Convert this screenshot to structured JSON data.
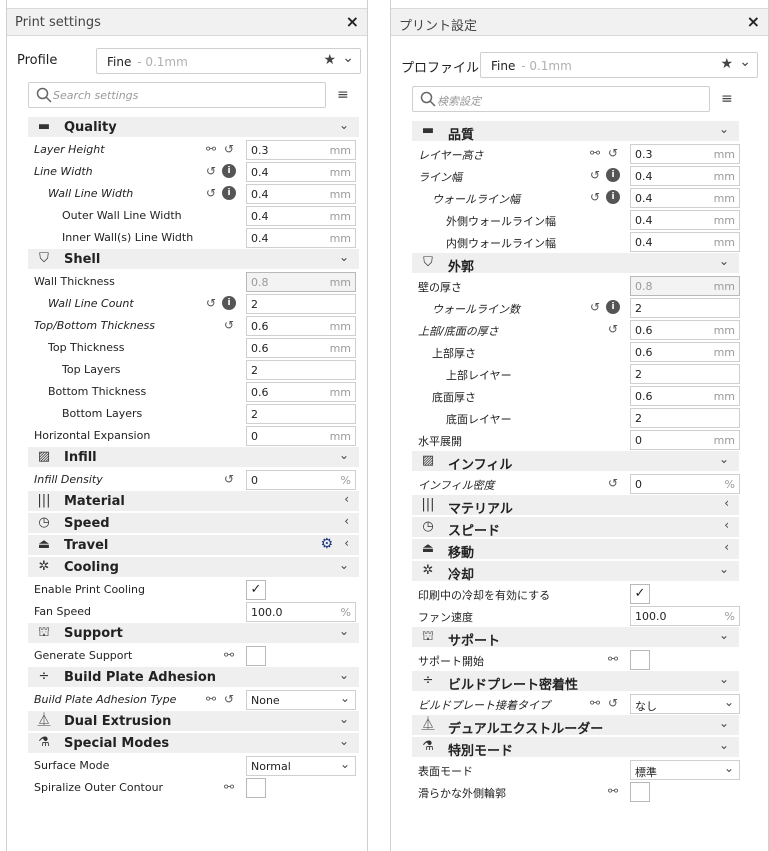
{
  "left": {
    "title": "Print settings",
    "close": "×",
    "profile_label": "Profile",
    "profile_name": "Fine",
    "profile_sub": "- 0.1mm",
    "search_placeholder": "Search settings",
    "rows": [
      {
        "kind": "cat",
        "icon": "quality-icon",
        "glyph": "▬",
        "label": "Quality",
        "arrow": "⌄"
      },
      {
        "kind": "setting",
        "label": "Layer Height",
        "italic": true,
        "indent": 0,
        "icons": [
          "link-icon",
          "reset-icon"
        ],
        "field": {
          "value": "0.3",
          "unit": "mm"
        }
      },
      {
        "kind": "setting",
        "label": "Line Width",
        "italic": true,
        "indent": 0,
        "icons": [
          "reset-icon",
          "info-icon"
        ],
        "field": {
          "value": "0.4",
          "unit": "mm"
        }
      },
      {
        "kind": "setting",
        "label": "Wall Line Width",
        "italic": true,
        "indent": 1,
        "icons": [
          "reset-icon",
          "info-icon"
        ],
        "field": {
          "value": "0.4",
          "unit": "mm"
        }
      },
      {
        "kind": "setting",
        "label": "Outer Wall Line Width",
        "italic": false,
        "indent": 2,
        "icons": [],
        "field": {
          "value": "0.4",
          "unit": "mm"
        }
      },
      {
        "kind": "setting",
        "label": "Inner Wall(s) Line Width",
        "italic": false,
        "indent": 2,
        "icons": [],
        "field": {
          "value": "0.4",
          "unit": "mm"
        }
      },
      {
        "kind": "cat",
        "icon": "shell-icon",
        "glyph": "⛉",
        "label": "Shell",
        "arrow": "⌄"
      },
      {
        "kind": "setting",
        "label": "Wall Thickness",
        "italic": false,
        "indent": 0,
        "icons": [],
        "field": {
          "value": "0.8",
          "unit": "mm",
          "disabled": true
        }
      },
      {
        "kind": "setting",
        "label": "Wall Line Count",
        "italic": true,
        "indent": 1,
        "icons": [
          "reset-icon",
          "info-icon"
        ],
        "field": {
          "value": "2",
          "unit": ""
        }
      },
      {
        "kind": "setting",
        "label": "Top/Bottom Thickness",
        "italic": true,
        "indent": 0,
        "icons": [
          "reset-icon"
        ],
        "field": {
          "value": "0.6",
          "unit": "mm"
        }
      },
      {
        "kind": "setting",
        "label": "Top Thickness",
        "italic": false,
        "indent": 1,
        "icons": [],
        "field": {
          "value": "0.6",
          "unit": "mm"
        }
      },
      {
        "kind": "setting",
        "label": "Top Layers",
        "italic": false,
        "indent": 2,
        "icons": [],
        "field": {
          "value": "2",
          "unit": ""
        }
      },
      {
        "kind": "setting",
        "label": "Bottom Thickness",
        "italic": false,
        "indent": 1,
        "icons": [],
        "field": {
          "value": "0.6",
          "unit": "mm"
        }
      },
      {
        "kind": "setting",
        "label": "Bottom Layers",
        "italic": false,
        "indent": 2,
        "icons": [],
        "field": {
          "value": "2",
          "unit": ""
        }
      },
      {
        "kind": "setting",
        "label": "Horizontal Expansion",
        "italic": false,
        "indent": 0,
        "icons": [],
        "field": {
          "value": "0",
          "unit": "mm"
        }
      },
      {
        "kind": "cat",
        "icon": "infill-icon",
        "glyph": "▨",
        "label": "Infill",
        "arrow": "⌄"
      },
      {
        "kind": "setting",
        "label": "Infill Density",
        "italic": true,
        "indent": 0,
        "icons": [
          "reset-icon"
        ],
        "field": {
          "value": "0",
          "unit": "%"
        }
      },
      {
        "kind": "cat",
        "icon": "material-icon",
        "glyph": "|||",
        "label": "Material",
        "arrow": "‹"
      },
      {
        "kind": "cat",
        "icon": "speed-icon",
        "glyph": "◷",
        "label": "Speed",
        "arrow": "‹"
      },
      {
        "kind": "cat",
        "icon": "travel-icon",
        "glyph": "⏏",
        "label": "Travel",
        "arrow": "‹",
        "gear": true
      },
      {
        "kind": "cat",
        "icon": "cooling-icon",
        "glyph": "✲",
        "label": "Cooling",
        "arrow": "⌄"
      },
      {
        "kind": "setting",
        "label": "Enable Print Cooling",
        "italic": false,
        "indent": 0,
        "icons": [],
        "check": "✓"
      },
      {
        "kind": "setting",
        "label": "Fan Speed",
        "italic": false,
        "indent": 0,
        "icons": [],
        "field": {
          "value": "100.0",
          "unit": "%"
        }
      },
      {
        "kind": "cat",
        "icon": "support-icon",
        "glyph": "⛫",
        "label": "Support",
        "arrow": "⌄"
      },
      {
        "kind": "setting",
        "label": "Generate Support",
        "italic": false,
        "indent": 0,
        "icons": [
          "link-icon"
        ],
        "check": ""
      },
      {
        "kind": "cat",
        "icon": "adhesion-icon",
        "glyph": "÷",
        "label": "Build Plate Adhesion",
        "arrow": "⌄"
      },
      {
        "kind": "setting",
        "label": "Build Plate Adhesion Type",
        "italic": true,
        "indent": 0,
        "icons": [
          "link-icon",
          "reset-icon"
        ],
        "select": "None"
      },
      {
        "kind": "cat",
        "icon": "dual-extrusion-icon",
        "glyph": "⏅",
        "label": "Dual Extrusion",
        "arrow": "⌄"
      },
      {
        "kind": "cat",
        "icon": "special-modes-icon",
        "glyph": "⚗",
        "label": "Special Modes",
        "arrow": "⌄"
      },
      {
        "kind": "setting",
        "label": "Surface Mode",
        "italic": false,
        "indent": 0,
        "icons": [],
        "select": "Normal"
      },
      {
        "kind": "setting",
        "label": "Spiralize Outer Contour",
        "italic": false,
        "indent": 0,
        "icons": [
          "link-icon"
        ],
        "check": ""
      }
    ]
  },
  "right": {
    "title": "プリント設定",
    "close": "×",
    "profile_label": "プロファイル",
    "profile_name": "Fine",
    "profile_sub": "- 0.1mm",
    "search_placeholder": "検索設定",
    "rows": [
      {
        "kind": "cat",
        "icon": "quality-icon",
        "glyph": "▬",
        "label": "品質",
        "arrow": "⌄"
      },
      {
        "kind": "setting",
        "label": "レイヤー高さ",
        "italic": true,
        "indent": 0,
        "icons": [
          "link-icon",
          "reset-icon"
        ],
        "field": {
          "value": "0.3",
          "unit": "mm"
        }
      },
      {
        "kind": "setting",
        "label": "ライン幅",
        "italic": true,
        "indent": 0,
        "icons": [
          "reset-icon",
          "info-icon"
        ],
        "field": {
          "value": "0.4",
          "unit": "mm"
        }
      },
      {
        "kind": "setting",
        "label": "ウォールライン幅",
        "italic": true,
        "indent": 1,
        "icons": [
          "reset-icon",
          "info-icon"
        ],
        "field": {
          "value": "0.4",
          "unit": "mm"
        }
      },
      {
        "kind": "setting",
        "label": "外側ウォールライン幅",
        "italic": false,
        "indent": 2,
        "icons": [],
        "field": {
          "value": "0.4",
          "unit": "mm"
        }
      },
      {
        "kind": "setting",
        "label": "内側ウォールライン幅",
        "italic": false,
        "indent": 2,
        "icons": [],
        "field": {
          "value": "0.4",
          "unit": "mm"
        }
      },
      {
        "kind": "cat",
        "icon": "shell-icon",
        "glyph": "⛉",
        "label": "外郭",
        "arrow": "⌄"
      },
      {
        "kind": "setting",
        "label": "壁の厚さ",
        "italic": false,
        "indent": 0,
        "icons": [],
        "field": {
          "value": "0.8",
          "unit": "mm",
          "disabled": true
        }
      },
      {
        "kind": "setting",
        "label": "ウォールライン数",
        "italic": true,
        "indent": 1,
        "icons": [
          "reset-icon",
          "info-icon"
        ],
        "field": {
          "value": "2",
          "unit": ""
        }
      },
      {
        "kind": "setting",
        "label": "上部/底面の厚さ",
        "italic": true,
        "indent": 0,
        "icons": [
          "reset-icon"
        ],
        "field": {
          "value": "0.6",
          "unit": "mm"
        }
      },
      {
        "kind": "setting",
        "label": "上部厚さ",
        "italic": false,
        "indent": 1,
        "icons": [],
        "field": {
          "value": "0.6",
          "unit": "mm"
        }
      },
      {
        "kind": "setting",
        "label": "上部レイヤー",
        "italic": false,
        "indent": 2,
        "icons": [],
        "field": {
          "value": "2",
          "unit": ""
        }
      },
      {
        "kind": "setting",
        "label": "底面厚さ",
        "italic": false,
        "indent": 1,
        "icons": [],
        "field": {
          "value": "0.6",
          "unit": "mm"
        }
      },
      {
        "kind": "setting",
        "label": "底面レイヤー",
        "italic": false,
        "indent": 2,
        "icons": [],
        "field": {
          "value": "2",
          "unit": ""
        }
      },
      {
        "kind": "setting",
        "label": "水平展開",
        "italic": false,
        "indent": 0,
        "icons": [],
        "field": {
          "value": "0",
          "unit": "mm"
        }
      },
      {
        "kind": "cat",
        "icon": "infill-icon",
        "glyph": "▨",
        "label": "インフィル",
        "arrow": "⌄"
      },
      {
        "kind": "setting",
        "label": "インフィル密度",
        "italic": true,
        "indent": 0,
        "icons": [
          "reset-icon"
        ],
        "field": {
          "value": "0",
          "unit": "%"
        }
      },
      {
        "kind": "cat",
        "icon": "material-icon",
        "glyph": "|||",
        "label": "マテリアル",
        "arrow": "‹"
      },
      {
        "kind": "cat",
        "icon": "speed-icon",
        "glyph": "◷",
        "label": "スピード",
        "arrow": "‹"
      },
      {
        "kind": "cat",
        "icon": "travel-icon",
        "glyph": "⏏",
        "label": "移動",
        "arrow": "‹"
      },
      {
        "kind": "cat",
        "icon": "cooling-icon",
        "glyph": "✲",
        "label": "冷却",
        "arrow": "⌄"
      },
      {
        "kind": "setting",
        "label": "印刷中の冷却を有効にする",
        "italic": false,
        "indent": 0,
        "icons": [],
        "check": "✓"
      },
      {
        "kind": "setting",
        "label": "ファン速度",
        "italic": false,
        "indent": 0,
        "icons": [],
        "field": {
          "value": "100.0",
          "unit": "%"
        }
      },
      {
        "kind": "cat",
        "icon": "support-icon",
        "glyph": "⛫",
        "label": "サポート",
        "arrow": "⌄"
      },
      {
        "kind": "setting",
        "label": "サポート開始",
        "italic": false,
        "indent": 0,
        "icons": [
          "link-icon"
        ],
        "check": ""
      },
      {
        "kind": "cat",
        "icon": "adhesion-icon",
        "glyph": "÷",
        "label": "ビルドプレート密着性",
        "arrow": "⌄"
      },
      {
        "kind": "setting",
        "label": "ビルドプレート接着タイプ",
        "italic": true,
        "indent": 0,
        "icons": [
          "link-icon",
          "reset-icon"
        ],
        "select": "なし"
      },
      {
        "kind": "cat",
        "icon": "dual-extrusion-icon",
        "glyph": "⏅",
        "label": "デュアルエクストルーダー",
        "arrow": "⌄"
      },
      {
        "kind": "cat",
        "icon": "special-modes-icon",
        "glyph": "⚗",
        "label": "特別モード",
        "arrow": "⌄"
      },
      {
        "kind": "setting",
        "label": "表面モード",
        "italic": false,
        "indent": 0,
        "icons": [],
        "select": "標準"
      },
      {
        "kind": "setting",
        "label": "滑らかな外側輪郭",
        "italic": false,
        "indent": 0,
        "icons": [
          "link-icon"
        ],
        "check": ""
      }
    ]
  },
  "icons": {
    "link": "⚯",
    "reset": "↺",
    "info": "i",
    "star": "★",
    "chevron": "⌄",
    "menu": "≡",
    "gear": "⚙",
    "gear_color": "#1a3780"
  }
}
